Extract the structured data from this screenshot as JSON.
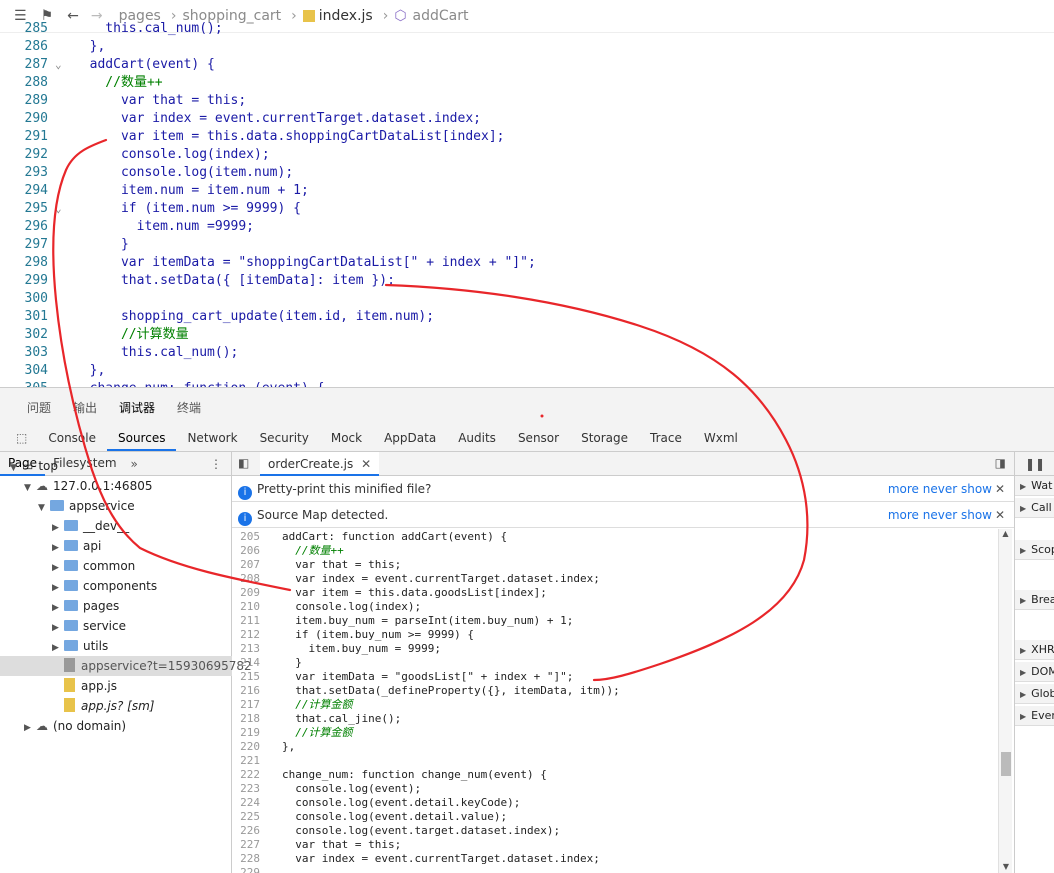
{
  "editor": {
    "breadcrumbs": [
      "pages",
      "shopping_cart",
      "index.js",
      "addCart"
    ],
    "lines": [
      {
        "no": "285",
        "code": "    this.cal_num();"
      },
      {
        "no": "286",
        "code": "  },"
      },
      {
        "no": "287",
        "code": "  addCart(event) {"
      },
      {
        "no": "288",
        "code": "    //数量++"
      },
      {
        "no": "289",
        "code": "      var that = this;"
      },
      {
        "no": "290",
        "code": "      var index = event.currentTarget.dataset.index;"
      },
      {
        "no": "291",
        "code": "      var item = this.data.shoppingCartDataList[index];"
      },
      {
        "no": "292",
        "code": "      console.log(index);"
      },
      {
        "no": "293",
        "code": "      console.log(item.num);"
      },
      {
        "no": "294",
        "code": "      item.num = item.num + 1;"
      },
      {
        "no": "295",
        "code": "      if (item.num >= 9999) {"
      },
      {
        "no": "296",
        "code": "        item.num =9999;"
      },
      {
        "no": "297",
        "code": "      }"
      },
      {
        "no": "298",
        "code": "      var itemData = \"shoppingCartDataList[\" + index + \"]\";"
      },
      {
        "no": "299",
        "code": "      that.setData({ [itemData]: item });"
      },
      {
        "no": "300",
        "code": ""
      },
      {
        "no": "301",
        "code": "      shopping_cart_update(item.id, item.num);"
      },
      {
        "no": "302",
        "code": "      //计算数量"
      },
      {
        "no": "303",
        "code": "      this.cal_num();"
      },
      {
        "no": "304",
        "code": "  },"
      },
      {
        "no": "305",
        "code": "  change_num: function (event) {"
      }
    ]
  },
  "devtools": {
    "console_tabs": [
      "问题",
      "输出",
      "调试器",
      "终端"
    ],
    "main_tabs": [
      "Console",
      "Sources",
      "Network",
      "Security",
      "Mock",
      "AppData",
      "Audits",
      "Sensor",
      "Storage",
      "Trace",
      "Wxml"
    ],
    "left_tabs": [
      "Page",
      "Filesystem"
    ],
    "tree": [
      {
        "label": "top",
        "indent": 0,
        "kind": "frame"
      },
      {
        "label": "127.0.0.1:46805",
        "indent": 1,
        "kind": "cloud"
      },
      {
        "label": "appservice",
        "indent": 2,
        "kind": "folder"
      },
      {
        "label": "__dev__",
        "indent": 3,
        "kind": "folder"
      },
      {
        "label": "api",
        "indent": 3,
        "kind": "folder"
      },
      {
        "label": "common",
        "indent": 3,
        "kind": "folder"
      },
      {
        "label": "components",
        "indent": 3,
        "kind": "folder"
      },
      {
        "label": "pages",
        "indent": 3,
        "kind": "folder"
      },
      {
        "label": "service",
        "indent": 3,
        "kind": "folder"
      },
      {
        "label": "utils",
        "indent": 3,
        "kind": "folder"
      },
      {
        "label": "appservice?t=15930695782",
        "indent": 3,
        "kind": "filegray"
      },
      {
        "label": "app.js",
        "indent": 3,
        "kind": "file"
      },
      {
        "label": "app.js? [sm]",
        "indent": 3,
        "kind": "file"
      },
      {
        "label": "(no domain)",
        "indent": 1,
        "kind": "cloud"
      }
    ],
    "open_file": "orderCreate.js",
    "info_bars": [
      {
        "text": "Pretty-print this minified file?",
        "links": "more  never show"
      },
      {
        "text": "Source Map detected.",
        "links": "more  never show"
      }
    ],
    "source_lines": [
      {
        "no": "205",
        "code": "addCart: function addCart(event) {"
      },
      {
        "no": "206",
        "code": "  //数量++"
      },
      {
        "no": "207",
        "code": "  var that = this;"
      },
      {
        "no": "208",
        "code": "  var index = event.currentTarget.dataset.index;"
      },
      {
        "no": "209",
        "code": "  var item = this.data.goodsList[index];"
      },
      {
        "no": "210",
        "code": "  console.log(index);"
      },
      {
        "no": "211",
        "code": "  item.buy_num = parseInt(item.buy_num) + 1;"
      },
      {
        "no": "212",
        "code": "  if (item.buy_num >= 9999) {"
      },
      {
        "no": "213",
        "code": "    item.buy_num = 9999;"
      },
      {
        "no": "214",
        "code": "  }"
      },
      {
        "no": "215",
        "code": "  var itemData = \"goodsList[\" + index + \"]\";"
      },
      {
        "no": "216",
        "code": "  that.setData(_defineProperty({}, itemData, itm));"
      },
      {
        "no": "217",
        "code": "  //计算金额"
      },
      {
        "no": "218",
        "code": "  that.cal_jine();"
      },
      {
        "no": "219",
        "code": "  //计算金额"
      },
      {
        "no": "220",
        "code": "},"
      },
      {
        "no": "221",
        "code": ""
      },
      {
        "no": "222",
        "code": "change_num: function change_num(event) {"
      },
      {
        "no": "223",
        "code": "  console.log(event);"
      },
      {
        "no": "224",
        "code": "  console.log(event.detail.keyCode);"
      },
      {
        "no": "225",
        "code": "  console.log(event.detail.value);"
      },
      {
        "no": "226",
        "code": "  console.log(event.target.dataset.index);"
      },
      {
        "no": "227",
        "code": "  var that = this;"
      },
      {
        "no": "228",
        "code": "  var index = event.currentTarget.dataset.index;"
      },
      {
        "no": "229",
        "code": ""
      }
    ],
    "right_panels": [
      "Wat",
      "Call",
      "Scop",
      "Brea",
      "XHR",
      "DOM",
      "Glob",
      "Ever"
    ]
  },
  "colors": {
    "annotation": "#e8262a",
    "accent": "#1a73e8"
  }
}
